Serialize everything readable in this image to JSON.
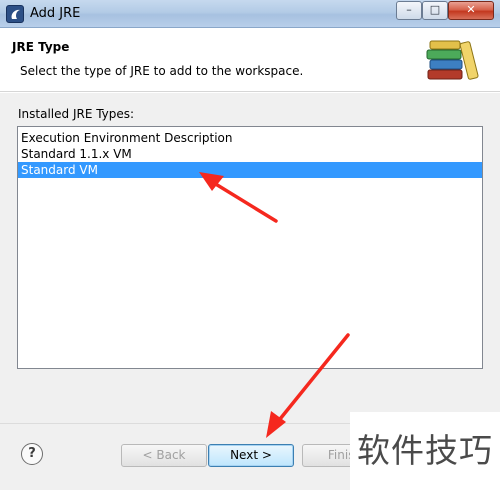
{
  "window": {
    "title": "Add JRE",
    "minimize": "–",
    "maximize": "□",
    "close": "✕"
  },
  "header": {
    "title": "JRE Type",
    "description": "Select the type of JRE to add to the workspace."
  },
  "list": {
    "label": "Installed JRE Types:",
    "items": [
      {
        "label": "Execution Environment Description"
      },
      {
        "label": "Standard 1.1.x VM"
      },
      {
        "label": "Standard VM"
      }
    ],
    "selected_index": 2
  },
  "footer": {
    "help": "?",
    "back": "< Back",
    "next": "Next >",
    "finish": "Finish"
  },
  "watermark": "软件技巧",
  "colors": {
    "selection": "#3399ff",
    "annotation_arrow": "#f5281e"
  }
}
